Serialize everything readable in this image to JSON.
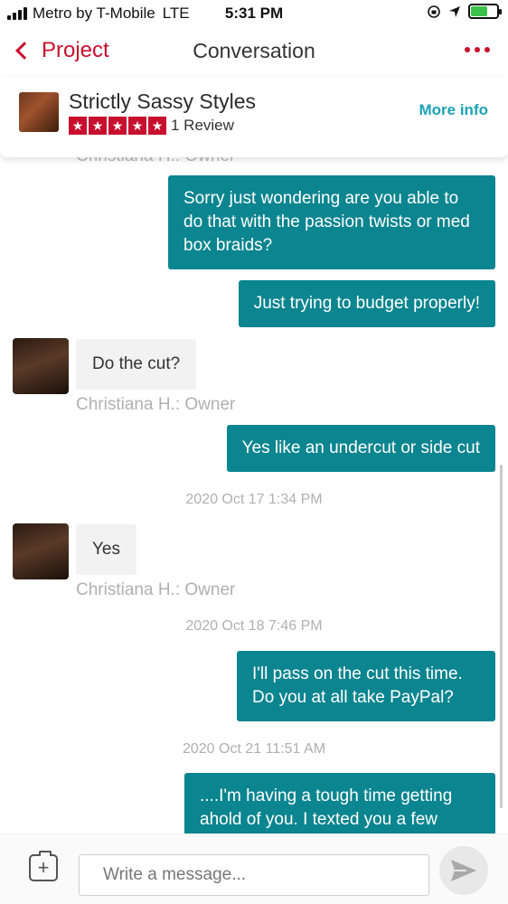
{
  "status_bar": {
    "carrier": "Metro by T-Mobile",
    "network": "LTE",
    "time": "5:31 PM"
  },
  "nav": {
    "back_label": "Project",
    "title": "Conversation"
  },
  "vendor": {
    "name": "Strictly Sassy Styles",
    "rating_stars": 5,
    "review_count": "1 Review",
    "more_info": "More info"
  },
  "messages": {
    "partial_sender": "Christiana H.: Owner",
    "items": [
      {
        "direction": "out",
        "text": "Sorry just wondering are you able to do that with the passion twists or med box braids?"
      },
      {
        "direction": "out",
        "text": "Just trying to budget properly!"
      },
      {
        "direction": "in",
        "text": "Do the cut?",
        "sender": "Christiana H.: Owner"
      },
      {
        "direction": "out",
        "text": "Yes like an undercut or side cut"
      },
      {
        "type": "timestamp",
        "text": "2020 Oct 17 1:34 PM"
      },
      {
        "direction": "in",
        "text": "Yes",
        "sender": "Christiana H.: Owner"
      },
      {
        "type": "timestamp",
        "text": "2020 Oct 18 7:46 PM"
      },
      {
        "direction": "out",
        "text": "I'll pass on the cut this time. Do you at all take PayPal?"
      },
      {
        "type": "timestamp",
        "text": "2020 Oct 21 11:51 AM"
      },
      {
        "direction": "out",
        "text": "....I'm having a tough time getting ahold of you. I texted you a few"
      }
    ]
  },
  "composer": {
    "placeholder": "Write a message..."
  },
  "colors": {
    "accent_red": "#c8102e",
    "bubble_teal": "#0b858f",
    "link_teal": "#1aa3b5"
  }
}
